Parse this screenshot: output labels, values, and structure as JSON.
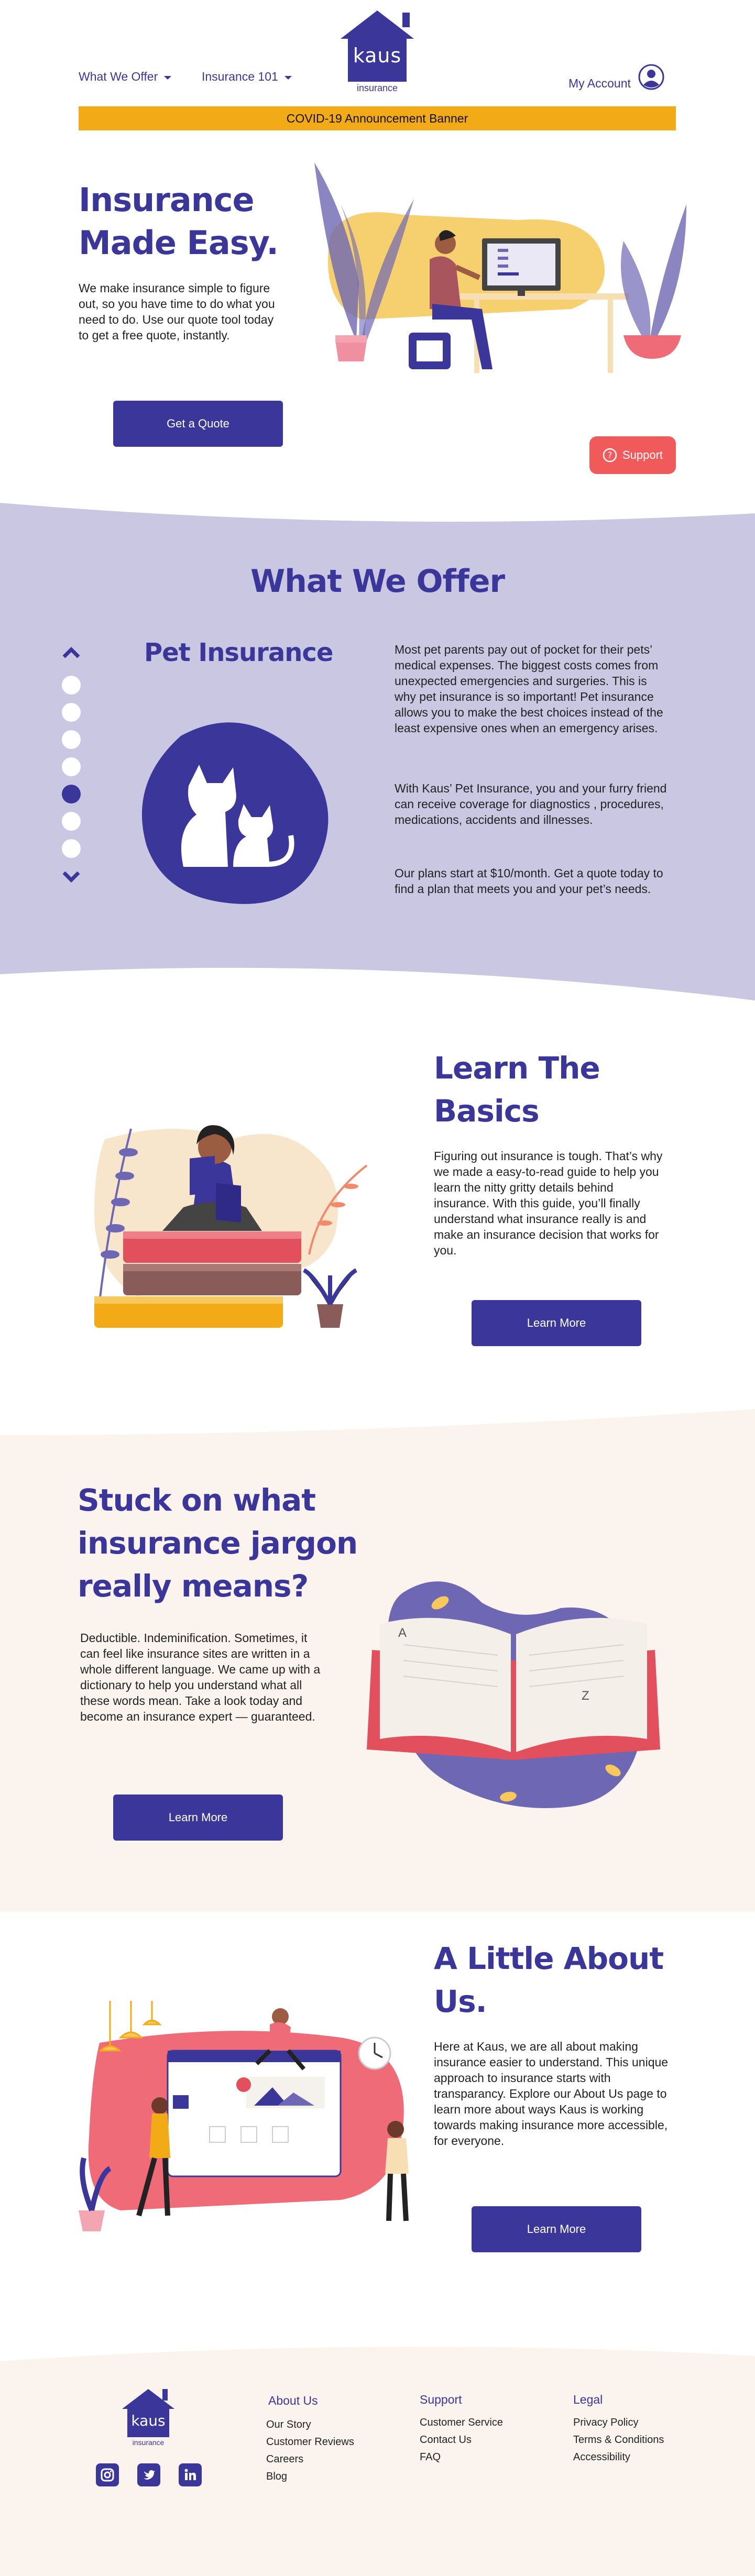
{
  "header": {
    "logo_text": "kaus",
    "logo_sub": "insurance",
    "nav": [
      {
        "label": "What We Offer"
      },
      {
        "label": "Insurance 101"
      }
    ],
    "account_label": "My Account",
    "banner": "COVID-19 Announcement Banner"
  },
  "hero": {
    "title_line1": "Insurance",
    "title_line2": "Made Easy.",
    "body": "We make insurance simple to figure out, so you have time to do what you need to do. Use our quote tool today to get a free quote, instantly.",
    "cta": "Get a Quote",
    "support": "Support"
  },
  "offer": {
    "heading": "What We Offer",
    "product_title": "Pet Insurance",
    "paragraphs": [
      "Most pet parents pay out of pocket for their pets’ medical expenses. The biggest costs comes from unexpected emergencies and surgeries. This is why pet insurance is so important! Pet insurance allows you to make the best choices instead of the least expensive ones when an emergency arises.",
      "With Kaus’ Pet Insurance, you and your furry friend can receive coverage for diagnostics , procedures, medications, accidents and illnesses.",
      "Our plans start at $10/month. Get a quote today to find a plan that meets you and your pet’s needs."
    ],
    "carousel_total": 7,
    "carousel_active": 5
  },
  "basics": {
    "title_line1": "Learn The",
    "title_line2": "Basics",
    "body": "Figuring out insurance is tough. That’s why we made a easy-to-read guide to help you learn the nitty gritty details behind insurance. With this guide, you’ll finally understand what insurance really is and make an insurance decision that works for you.",
    "cta": "Learn More"
  },
  "jargon": {
    "title_line1": "Stuck on what",
    "title_line2": "insurance jargon",
    "title_line3": "really means?",
    "body": "Deductible. Indeminification. Sometimes, it can feel like insurance sites are written in a whole different language. We came up with a dictionary to help you understand what all these words mean. Take a look today and become an insurance expert — guaranteed.",
    "cta": "Learn More",
    "book_letters": [
      "A",
      "Z"
    ]
  },
  "about": {
    "title_line1": "A Little About",
    "title_line2": "Us.",
    "body": "Here at Kaus, we are all about making insurance easier to understand. This unique approach to insurance starts with transparancy. Explore our About Us page to learn more about ways Kaus is working towards making insurance more accessible, for everyone.",
    "cta": "Learn More"
  },
  "footer": {
    "logo_text": "kaus",
    "logo_sub": "insurance",
    "columns": [
      {
        "title": "About Us",
        "links": [
          "Our Story",
          "Customer Reviews",
          "Careers",
          "Blog"
        ]
      },
      {
        "title": "Support",
        "links": [
          "Customer Service",
          "Contact Us",
          "FAQ"
        ]
      },
      {
        "title": "Legal",
        "links": [
          "Privacy Policy",
          "Terms & Conditions",
          "Accessibility"
        ]
      }
    ],
    "social": [
      "instagram-icon",
      "twitter-icon",
      "linkedin-icon"
    ]
  },
  "colors": {
    "brand": "#3b3699",
    "banner": "#f2aa17",
    "lavender": "#c9c7e2",
    "beige": "#fbf4ee",
    "support": "#f05a5a"
  }
}
